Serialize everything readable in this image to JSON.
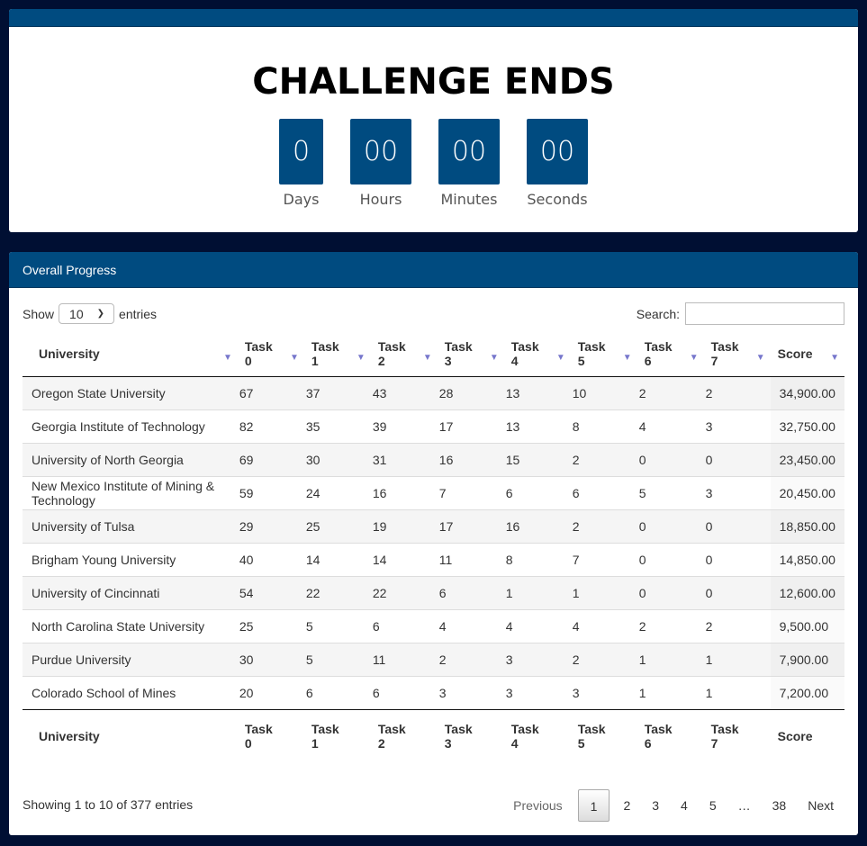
{
  "countdown": {
    "title": "CHALLENGE ENDS",
    "units": [
      {
        "value": "0",
        "label": "Days"
      },
      {
        "value": "00",
        "label": "Hours"
      },
      {
        "value": "00",
        "label": "Minutes"
      },
      {
        "value": "00",
        "label": "Seconds"
      }
    ]
  },
  "panel": {
    "title": "Overall Progress",
    "show_label": "Show",
    "entries_label": "entries",
    "page_length": "10",
    "search_label": "Search:",
    "search_value": ""
  },
  "columns": [
    {
      "l1": "University",
      "l2": ""
    },
    {
      "l1": "Task",
      "l2": "0"
    },
    {
      "l1": "Task",
      "l2": "1"
    },
    {
      "l1": "Task",
      "l2": "2"
    },
    {
      "l1": "Task",
      "l2": "3"
    },
    {
      "l1": "Task",
      "l2": "4"
    },
    {
      "l1": "Task",
      "l2": "5"
    },
    {
      "l1": "Task",
      "l2": "6"
    },
    {
      "l1": "Task",
      "l2": "7"
    },
    {
      "l1": "Score",
      "l2": ""
    }
  ],
  "rows": [
    [
      "Oregon State University",
      "67",
      "37",
      "43",
      "28",
      "13",
      "10",
      "2",
      "2",
      "34,900.00"
    ],
    [
      "Georgia Institute of Technology",
      "82",
      "35",
      "39",
      "17",
      "13",
      "8",
      "4",
      "3",
      "32,750.00"
    ],
    [
      "University of North Georgia",
      "69",
      "30",
      "31",
      "16",
      "15",
      "2",
      "0",
      "0",
      "23,450.00"
    ],
    [
      "New Mexico Institute of Mining & Technology",
      "59",
      "24",
      "16",
      "7",
      "6",
      "6",
      "5",
      "3",
      "20,450.00"
    ],
    [
      "University of Tulsa",
      "29",
      "25",
      "19",
      "17",
      "16",
      "2",
      "0",
      "0",
      "18,850.00"
    ],
    [
      "Brigham Young University",
      "40",
      "14",
      "14",
      "11",
      "8",
      "7",
      "0",
      "0",
      "14,850.00"
    ],
    [
      "University of Cincinnati",
      "54",
      "22",
      "22",
      "6",
      "1",
      "1",
      "0",
      "0",
      "12,600.00"
    ],
    [
      "North Carolina State University",
      "25",
      "5",
      "6",
      "4",
      "4",
      "4",
      "2",
      "2",
      "9,500.00"
    ],
    [
      "Purdue University",
      "30",
      "5",
      "11",
      "2",
      "3",
      "2",
      "1",
      "1",
      "7,900.00"
    ],
    [
      "Colorado School of Mines",
      "20",
      "6",
      "6",
      "3",
      "3",
      "3",
      "1",
      "1",
      "7,200.00"
    ]
  ],
  "info": "Showing 1 to 10 of 377 entries",
  "pagination": {
    "previous": "Previous",
    "pages": [
      "1",
      "2",
      "3",
      "4",
      "5",
      "…",
      "38"
    ],
    "next": "Next"
  }
}
